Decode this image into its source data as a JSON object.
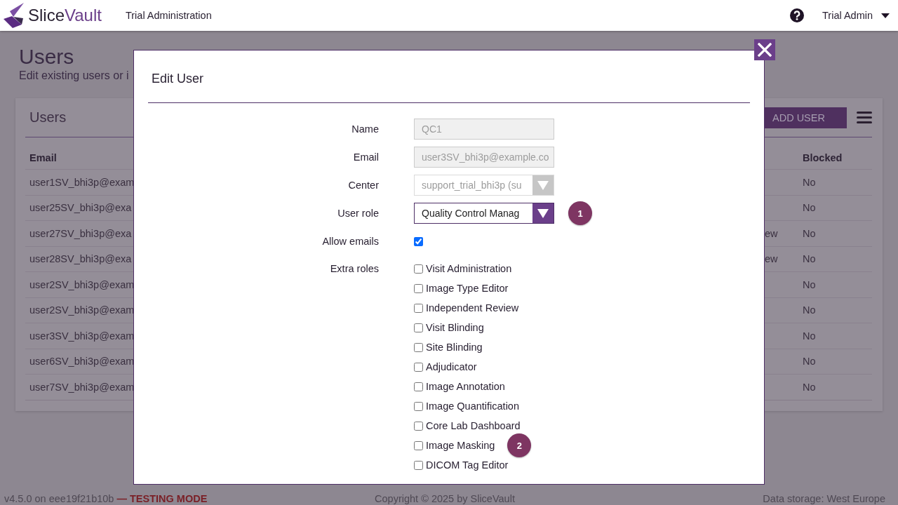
{
  "header": {
    "brand": {
      "part_1": "Slice",
      "part_2": "Vault"
    },
    "section": "Trial Administration",
    "user_menu": "Trial Admin"
  },
  "page": {
    "title": "Users",
    "subtitle": "Edit existing users or i"
  },
  "users_card": {
    "title": "Users",
    "add_button": "ADD USER",
    "table": {
      "columns": {
        "email": "Email",
        "blocked": "Blocked"
      },
      "rows": [
        {
          "email": "user1SV_bhi3p@exam",
          "blocked": "No"
        },
        {
          "email": "user25SV_bhi3p@exa",
          "blocked": "No"
        },
        {
          "email": "user27SV_bhi3p@exa",
          "column_3": "ew",
          "blocked": "No"
        },
        {
          "email": "user28SV_bhi3p@exa",
          "column_3": "ew",
          "blocked": "No"
        },
        {
          "email": "user2SV_bhi3p@exam",
          "blocked": "No"
        },
        {
          "email": "user2SV_bhi3p@exam",
          "blocked": "No"
        },
        {
          "email": "user3SV_bhi3p@exam",
          "blocked": "No"
        },
        {
          "email": "user6SV_bhi3p@exam",
          "blocked": "No"
        },
        {
          "email": "user7SV_bhi3p@exam",
          "blocked": "No"
        }
      ]
    }
  },
  "modal": {
    "title": "Edit User",
    "fields": [
      {
        "kind": "text",
        "label": "Name",
        "value": "QC1",
        "disabled": true
      },
      {
        "kind": "text",
        "label": "Email",
        "value": "user3SV_bhi3p@example.co",
        "disabled": true
      },
      {
        "kind": "select",
        "label": "Center",
        "value": "support_trial_bhi3p (su",
        "disabled": true
      },
      {
        "kind": "select",
        "label": "User role",
        "value": "Quality Control Manag",
        "disabled": false,
        "badge": "1"
      },
      {
        "kind": "checkbox",
        "label": "Allow emails",
        "checked": true
      },
      {
        "kind": "checklist",
        "label": "Extra roles",
        "options": [
          {
            "label": "Visit Administration",
            "checked": false
          },
          {
            "label": "Image Type Editor",
            "checked": false
          },
          {
            "label": "Independent Review",
            "checked": false
          },
          {
            "label": "Visit Blinding",
            "checked": false
          },
          {
            "label": "Site Blinding",
            "checked": false
          },
          {
            "label": "Adjudicator",
            "checked": false
          },
          {
            "label": "Image Annotation",
            "checked": false
          },
          {
            "label": "Image Quantification",
            "checked": false
          },
          {
            "label": "Core Lab Dashboard",
            "checked": false
          },
          {
            "label": "Image Masking",
            "checked": false,
            "badge": "2"
          },
          {
            "label": "DICOM Tag Editor",
            "checked": false
          }
        ]
      }
    ]
  },
  "footer": {
    "version": "v4.5.0 on eee19f21b10b",
    "mode": "— TESTING MODE",
    "copyright": "Copyright © 2025 by SliceVault",
    "storage": "Data storage: West Europe"
  }
}
